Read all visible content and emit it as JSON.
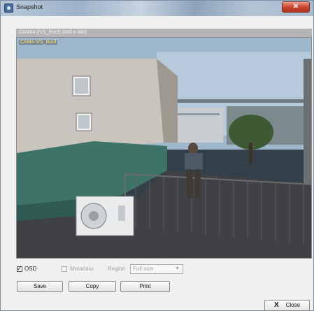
{
  "window": {
    "title": "Snapshot"
  },
  "camera": {
    "info": "CAM04 (IVS_Roof) (640 x 480)",
    "osd_label": "CAM4 IVS_Roof"
  },
  "controls": {
    "osd": {
      "label": "OSD",
      "checked": true
    },
    "metadata": {
      "label": "Metadata",
      "checked": false,
      "enabled": false
    },
    "region": {
      "label": "Region",
      "value": "Full size",
      "enabled": false
    }
  },
  "buttons": {
    "save": "Save",
    "copy": "Copy",
    "print": "Print",
    "close": "Close",
    "close_glyph": "X"
  },
  "colors": {
    "osd_text": "#ffe566",
    "titlebar_close": "#c7402a"
  }
}
